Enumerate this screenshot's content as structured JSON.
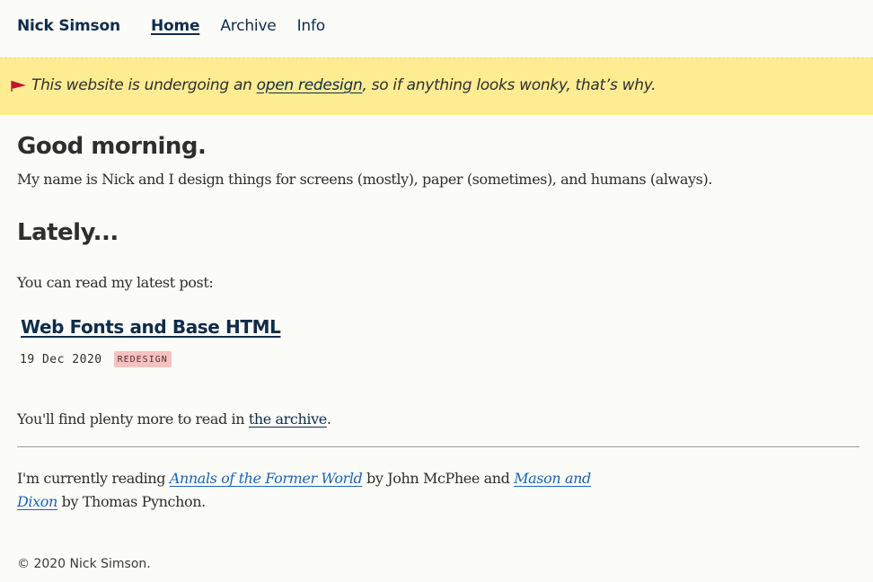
{
  "header": {
    "site_name": "Nick Simson",
    "nav": [
      {
        "label": "Home",
        "active": true
      },
      {
        "label": "Archive",
        "active": false
      },
      {
        "label": "Info",
        "active": false
      }
    ]
  },
  "banner": {
    "icon": "flag-icon",
    "text_before": "This website is undergoing an ",
    "link_text": "open redesign",
    "text_after": ", so if anything looks wonky, that’s why.",
    "background_color": "#feec93",
    "flag_color": "#c8102e"
  },
  "main": {
    "greeting": "Good morning.",
    "intro": "My name is Nick and I design things for screens (mostly), paper (sometimes), and humans (always).",
    "lately_heading": "Lately...",
    "latest_lead": "You can read my latest post:",
    "latest_post": {
      "title": "Web Fonts and Base HTML",
      "date": "19 Dec 2020",
      "tag": "REDESIGN"
    },
    "archive_line": {
      "before": "You'll find plenty more to read in ",
      "link_text": "the archive",
      "after": "."
    },
    "reading": {
      "before": "I'm currently reading ",
      "book1": "Annals of the Former World",
      "middle": " by John McPhee and ",
      "book2": "Mason and Dixon",
      "after": " by Thomas Pynchon."
    }
  },
  "footer": {
    "copyright": "© 2020 Nick Simson."
  }
}
